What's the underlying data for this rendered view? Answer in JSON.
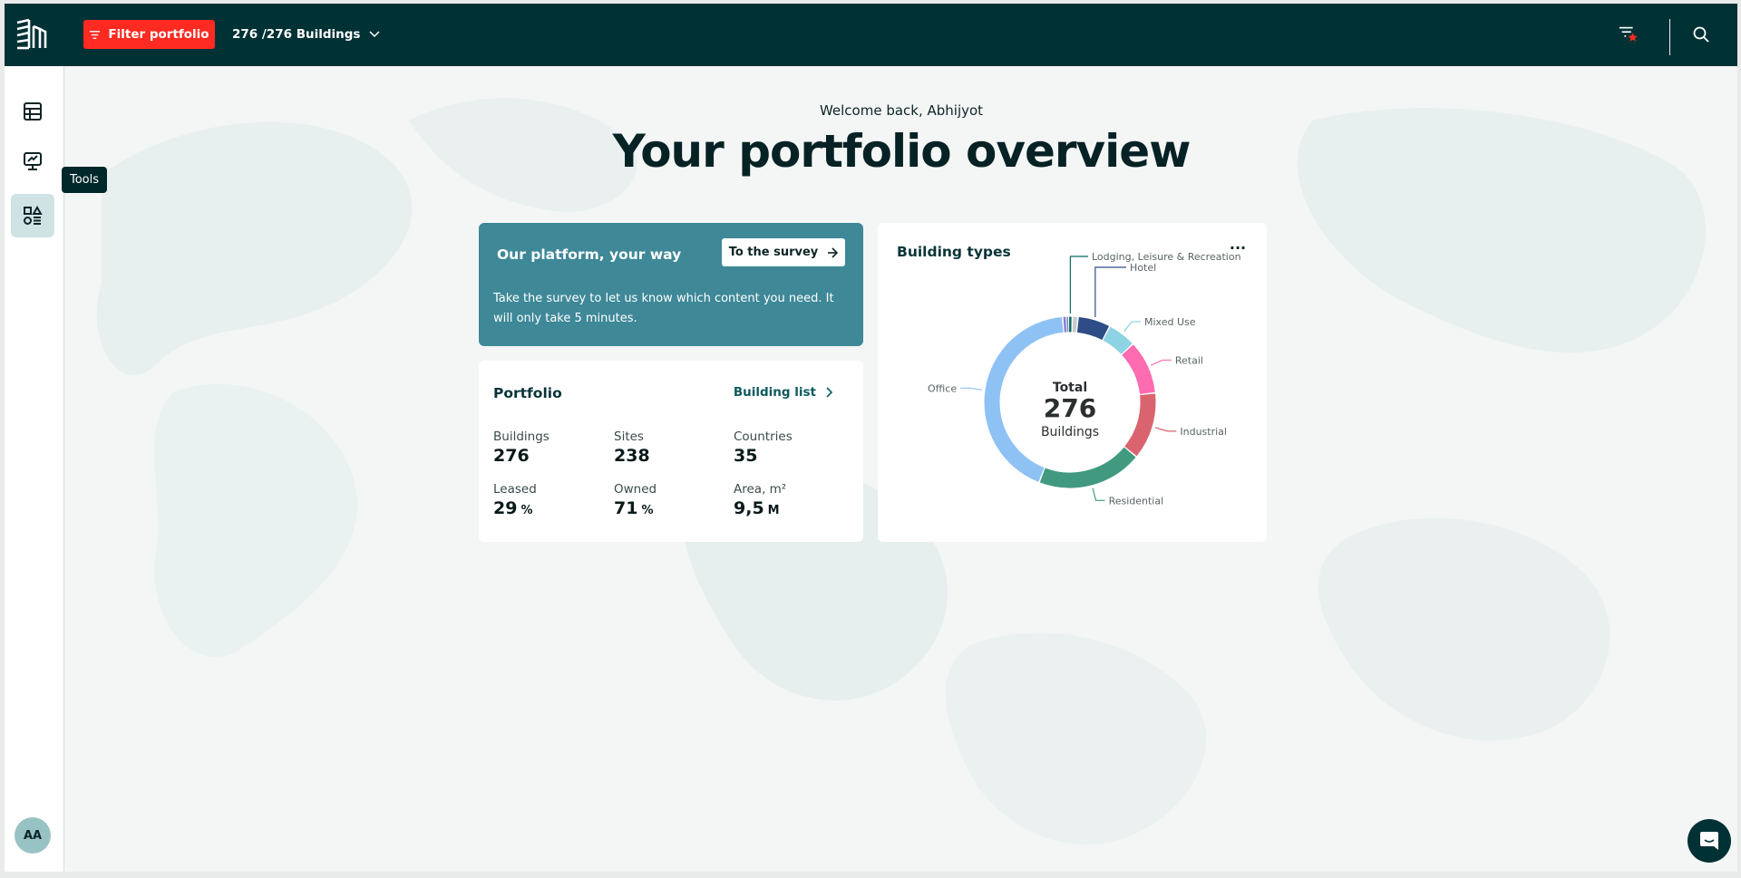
{
  "header": {
    "filter_label": "Filter portfolio",
    "buildings_selector": "276 /276 Buildings",
    "accent": "#ff2a21",
    "bg": "#003135"
  },
  "sidebar": {
    "items": [
      {
        "name": "table",
        "label": "Table"
      },
      {
        "name": "dashboard",
        "label": "Dashboard"
      },
      {
        "name": "tools",
        "label": "Tools",
        "active": true
      }
    ],
    "tooltip": "Tools",
    "avatar_initials": "AA"
  },
  "main": {
    "welcome": "Welcome back, Abhijyot",
    "title": "Your portfolio overview"
  },
  "survey": {
    "title": "Our platform, your way",
    "button": "To the survey",
    "text": "Take the survey to let us know which content you need. It will only take 5 minutes."
  },
  "portfolio": {
    "title": "Portfolio",
    "link": "Building list",
    "stats": [
      {
        "label": "Buildings",
        "value": "276",
        "unit": ""
      },
      {
        "label": "Sites",
        "value": "238",
        "unit": ""
      },
      {
        "label": "Countries",
        "value": "35",
        "unit": ""
      },
      {
        "label": "Leased",
        "value": "29",
        "unit": "%"
      },
      {
        "label": "Owned",
        "value": "71",
        "unit": "%"
      },
      {
        "label": "Area, m²",
        "value": "9,5",
        "unit": "M"
      }
    ]
  },
  "building_types": {
    "title": "Building types",
    "more_label": "···",
    "center_top": "Total",
    "center_value": "276",
    "center_bottom": "Buildings"
  },
  "chart_data": {
    "type": "pie",
    "title": "Building types",
    "total": 276,
    "slices": [
      {
        "label": "",
        "value": 2,
        "color": "#8f7ad6",
        "labeled": false
      },
      {
        "label": "",
        "value": 1,
        "color": "#6b8bb0",
        "labeled": false
      },
      {
        "label": "Lodging, Leisure & Recreation",
        "value": 2,
        "color": "#0b6a64",
        "labeled": true
      },
      {
        "label": "",
        "value": 3,
        "color": "#c9cccd",
        "labeled": false
      },
      {
        "label": "Hotel",
        "value": 17,
        "color": "#2e4d86",
        "labeled": true
      },
      {
        "label": "Mixed Use",
        "value": 15,
        "color": "#8dd3e3",
        "labeled": true
      },
      {
        "label": "Retail",
        "value": 28,
        "color": "#fd6bb0",
        "labeled": true
      },
      {
        "label": "Industrial",
        "value": 35,
        "color": "#d9646f",
        "labeled": true
      },
      {
        "label": "Residential",
        "value": 55,
        "color": "#419a80",
        "labeled": true
      },
      {
        "label": "Office",
        "value": 118,
        "color": "#8ec2f5",
        "labeled": true
      }
    ]
  }
}
